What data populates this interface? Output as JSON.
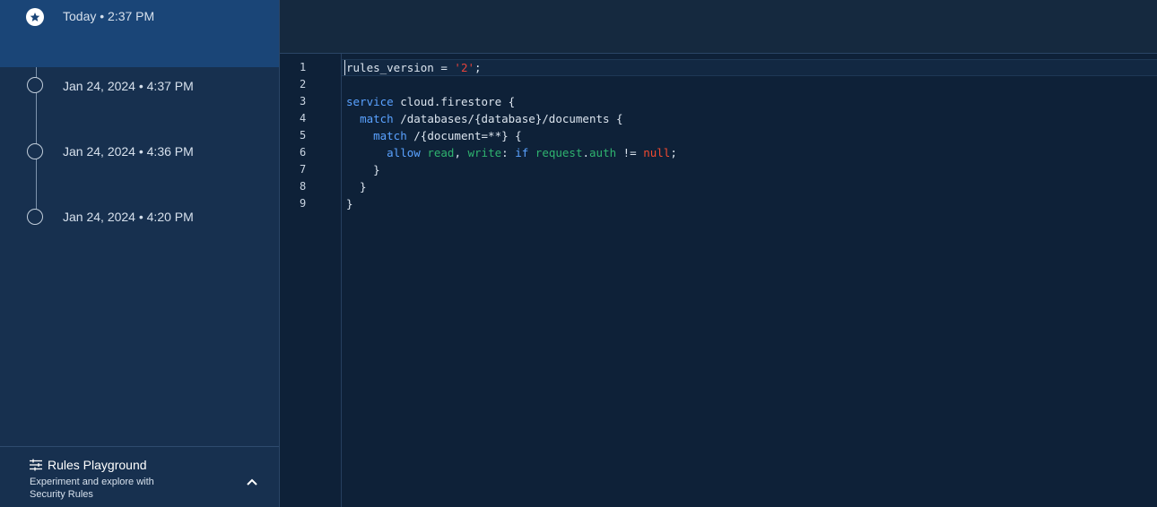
{
  "history": {
    "items": [
      {
        "label": "Today • 2:37 PM",
        "active": true
      },
      {
        "label": "Jan 24, 2024 • 4:37 PM",
        "active": false
      },
      {
        "label": "Jan 24, 2024 • 4:36 PM",
        "active": false
      },
      {
        "label": "Jan 24, 2024 • 4:20 PM",
        "active": false
      }
    ]
  },
  "playground": {
    "title": "Rules Playground",
    "subtitle": "Experiment and explore with Security Rules"
  },
  "editor": {
    "line_numbers": [
      "1",
      "2",
      "3",
      "4",
      "5",
      "6",
      "7",
      "8",
      "9"
    ],
    "lines": [
      [
        {
          "t": "rules_version = ",
          "c": "plain"
        },
        {
          "t": "'2'",
          "c": "str"
        },
        {
          "t": ";",
          "c": "plain"
        }
      ],
      [],
      [
        {
          "t": "service",
          "c": "kw"
        },
        {
          "t": " cloud.firestore {",
          "c": "plain"
        }
      ],
      [
        {
          "t": "  ",
          "c": "plain"
        },
        {
          "t": "match",
          "c": "kw"
        },
        {
          "t": " /databases/{database}/documents {",
          "c": "plain"
        }
      ],
      [
        {
          "t": "    ",
          "c": "plain"
        },
        {
          "t": "match",
          "c": "kw"
        },
        {
          "t": " /{document=**} {",
          "c": "plain"
        }
      ],
      [
        {
          "t": "      ",
          "c": "plain"
        },
        {
          "t": "allow",
          "c": "kw"
        },
        {
          "t": " ",
          "c": "plain"
        },
        {
          "t": "read",
          "c": "green"
        },
        {
          "t": ", ",
          "c": "plain"
        },
        {
          "t": "write",
          "c": "green"
        },
        {
          "t": ": ",
          "c": "plain"
        },
        {
          "t": "if",
          "c": "kw"
        },
        {
          "t": " ",
          "c": "plain"
        },
        {
          "t": "request",
          "c": "green"
        },
        {
          "t": ".",
          "c": "plain"
        },
        {
          "t": "auth",
          "c": "green"
        },
        {
          "t": " != ",
          "c": "plain"
        },
        {
          "t": "null",
          "c": "red"
        },
        {
          "t": ";",
          "c": "plain"
        }
      ],
      [
        {
          "t": "    }",
          "c": "plain"
        }
      ],
      [
        {
          "t": "  }",
          "c": "plain"
        }
      ],
      [
        {
          "t": "}",
          "c": "plain"
        }
      ]
    ]
  },
  "colors": {
    "sidebar_bg": "#17304f",
    "active_item_bg": "#1a4577",
    "editor_bg": "#0e2138",
    "keyword": "#5aa2ff",
    "string": "#e4433c",
    "identifier_green": "#2fb36f",
    "null_red": "#f24a30"
  },
  "icons": {
    "active_history": "star-circle-icon",
    "history": "circle-outline-icon",
    "playground": "tune-icon",
    "collapse": "chevron-up-icon"
  }
}
